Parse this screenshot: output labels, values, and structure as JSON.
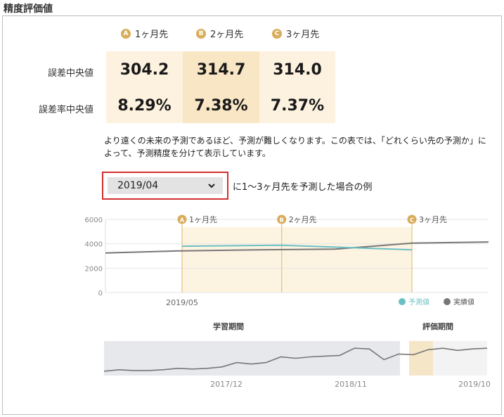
{
  "page_title": "精度評価値",
  "table": {
    "columns": [
      {
        "badge": "A",
        "label": "1ヶ月先"
      },
      {
        "badge": "B",
        "label": "2ヶ月先"
      },
      {
        "badge": "C",
        "label": "3ヶ月先"
      }
    ],
    "rows": [
      {
        "label": "誤差中央値",
        "values": [
          "304.2",
          "314.7",
          "314.0"
        ]
      },
      {
        "label": "誤差率中央値",
        "values": [
          "8.29%",
          "7.38%",
          "7.37%"
        ]
      }
    ]
  },
  "description": "より遠くの未来の予測であるほど、予測が難しくなります。この表では、「どれくらい先の予測か」によって、予測精度を分けて表示しています。",
  "selector": {
    "value": "2019/04",
    "caption": "に1〜3ヶ月先を予測した場合の例"
  },
  "chart_data": [
    {
      "type": "line",
      "title": "",
      "y_ticks": [
        "6000",
        "4000",
        "2000",
        "0"
      ],
      "ylim": [
        0,
        6000
      ],
      "x_label": "2019/05",
      "markers": [
        {
          "badge": "A",
          "label": "1ヶ月先"
        },
        {
          "badge": "B",
          "label": "2ヶ月先"
        },
        {
          "badge": "C",
          "label": "3ヶ月先"
        }
      ],
      "legend": [
        {
          "name": "予測値",
          "color": "#6bbfc4"
        },
        {
          "name": "実績値",
          "color": "#777777"
        }
      ],
      "series": [
        {
          "name": "実績値",
          "x": [
            0,
            1,
            2,
            3,
            4,
            5
          ],
          "values": [
            3250,
            3420,
            3500,
            3560,
            4050,
            4150
          ]
        },
        {
          "name": "予測値",
          "x": [
            1,
            2,
            3
          ],
          "values": [
            3800,
            3880,
            3500
          ]
        }
      ]
    },
    {
      "type": "line",
      "labels": {
        "train": "学習期間",
        "eval": "評価期間"
      },
      "x_ticks": [
        "2017/12",
        "2018/11",
        "2019/10"
      ],
      "series": [
        {
          "name": "実績値",
          "values": [
            3100,
            3200,
            3150,
            3150,
            3200,
            3300,
            3250,
            3300,
            3400,
            3700,
            3600,
            3700,
            4100,
            4000,
            4100,
            4150,
            4200,
            4700,
            4650,
            3900,
            4300,
            4250,
            4600,
            4700,
            4550,
            4650,
            4700
          ]
        }
      ],
      "colors": {
        "train_band": "#e6e8eb",
        "eval_band": "#f6e6c8",
        "after_band": "#f3f3f3",
        "line": "#777777"
      }
    }
  ]
}
